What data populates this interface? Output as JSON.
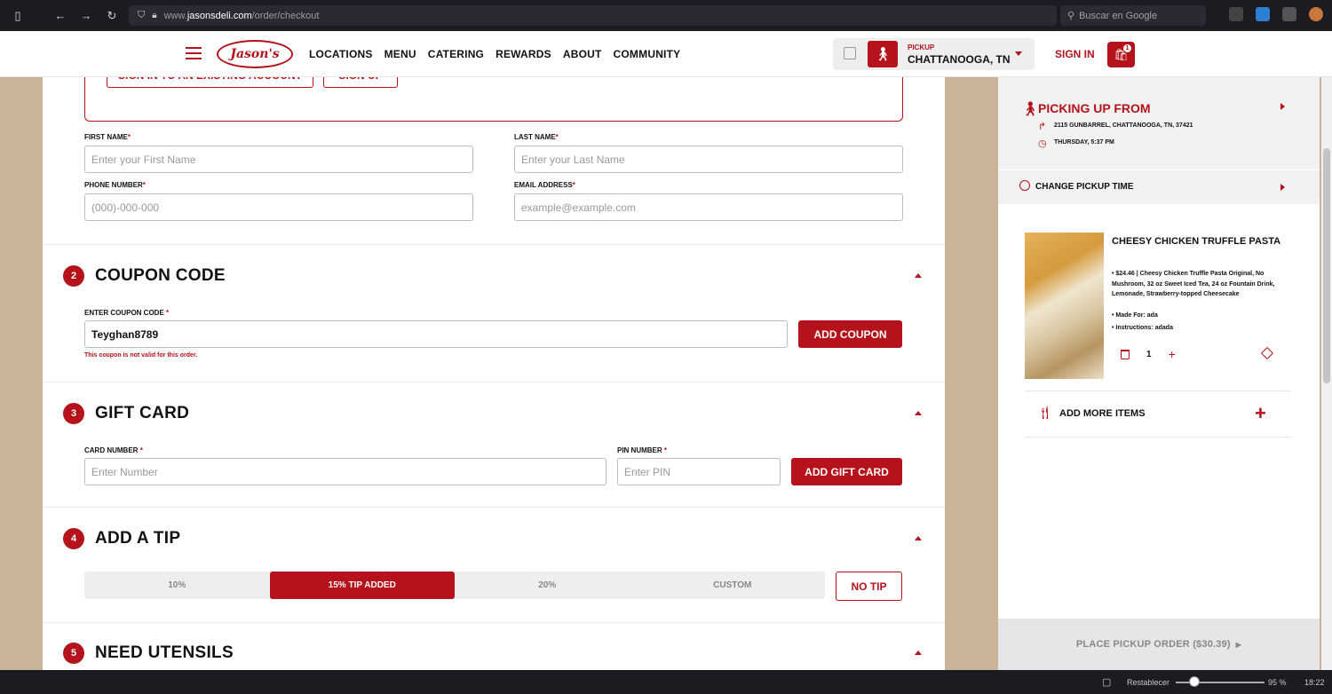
{
  "browser": {
    "url_prefix": "www.",
    "url_domain": "jasonsdeli.com",
    "url_path": "/order/checkout",
    "search_placeholder": "Buscar en Google"
  },
  "header": {
    "logo_text": "Jason's",
    "nav": [
      "LOCATIONS",
      "MENU",
      "CATERING",
      "REWARDS",
      "ABOUT",
      "COMMUNITY"
    ],
    "pickup_label": "PICKUP",
    "pickup_location": "CHATTANOOGA, TN",
    "sign_in": "SIGN IN",
    "cart_count": "1"
  },
  "account": {
    "sign_in_existing": "SIGN IN TO AN EXISTING ACCOUNT",
    "sign_up": "SIGN UP"
  },
  "contact": {
    "first_name_label": "FIRST NAME",
    "first_name_placeholder": "Enter your First Name",
    "last_name_label": "LAST NAME",
    "last_name_placeholder": "Enter your Last Name",
    "phone_label": "PHONE NUMBER",
    "phone_placeholder": "(000)-000-000",
    "email_label": "EMAIL ADDRESS",
    "email_placeholder": "example@example.com",
    "required_mark": "*"
  },
  "coupon": {
    "number": "2",
    "title": "COUPON CODE",
    "label": "ENTER COUPON CODE",
    "value": "Teyghan8789",
    "button": "ADD COUPON",
    "error": "This coupon is not valid for this order."
  },
  "gift_card": {
    "number": "3",
    "title": "GIFT CARD",
    "card_label": "CARD NUMBER",
    "card_placeholder": "Enter Number",
    "pin_label": "PIN NUMBER",
    "pin_placeholder": "Enter PIN",
    "button": "ADD GIFT CARD"
  },
  "tip": {
    "number": "4",
    "title": "ADD A TIP",
    "options": [
      "10%",
      "15% TIP ADDED",
      "20%",
      "CUSTOM"
    ],
    "no_tip": "NO TIP"
  },
  "utensils": {
    "number": "5",
    "title": "NEED UTENSILS"
  },
  "sidebar": {
    "picking_up_title": "PICKING UP FROM",
    "address": "2115 GUNBARREL, CHATTANOOGA, TN, 37421",
    "time": "THURSDAY, 5:37 PM",
    "change_time": "CHANGE PICKUP TIME",
    "item_name": "CHEESY CHICKEN TRUFFLE PASTA",
    "item_desc": "• $24.46 | Cheesy Chicken Truffle Pasta Original, No Mushroom, 32 oz Sweet Iced Tea, 24 oz Fountain Drink, Lemonade, Strawberry-topped Cheesecake",
    "made_for": "• Made For: ada",
    "instructions": "• Instructions: adada",
    "quantity": "1",
    "add_more": "ADD MORE ITEMS",
    "place_order": "PLACE PICKUP ORDER ($30.39)"
  },
  "statusbar": {
    "reset": "Restablecer",
    "zoom": "95 %",
    "clock": "18:22"
  },
  "colors": {
    "brand_red": "#b5121b",
    "background_kraft": "#c9b49a"
  }
}
